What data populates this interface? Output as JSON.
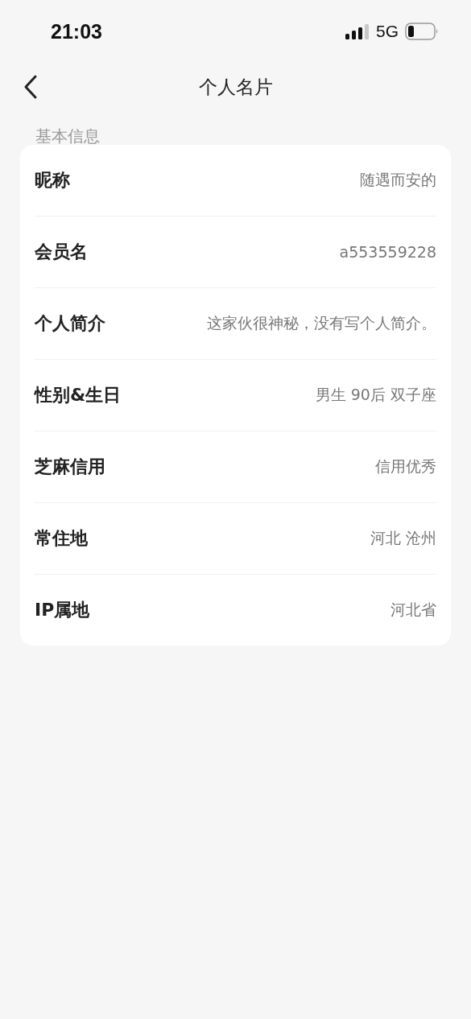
{
  "status_bar": {
    "time": "21:03",
    "network": "5G"
  },
  "nav": {
    "title": "个人名片"
  },
  "section": {
    "title": "基本信息"
  },
  "rows": [
    {
      "label": "昵称",
      "value": "随遇而安的"
    },
    {
      "label": "会员名",
      "value": "a553559228"
    },
    {
      "label": "个人简介",
      "value": "这家伙很神秘，没有写个人简介。"
    },
    {
      "label": "性别&生日",
      "value": "男生 90后 双子座"
    },
    {
      "label": "芝麻信用",
      "value": "信用优秀"
    },
    {
      "label": "常住地",
      "value": "河北 沧州"
    },
    {
      "label": "IP属地",
      "value": "河北省"
    }
  ]
}
